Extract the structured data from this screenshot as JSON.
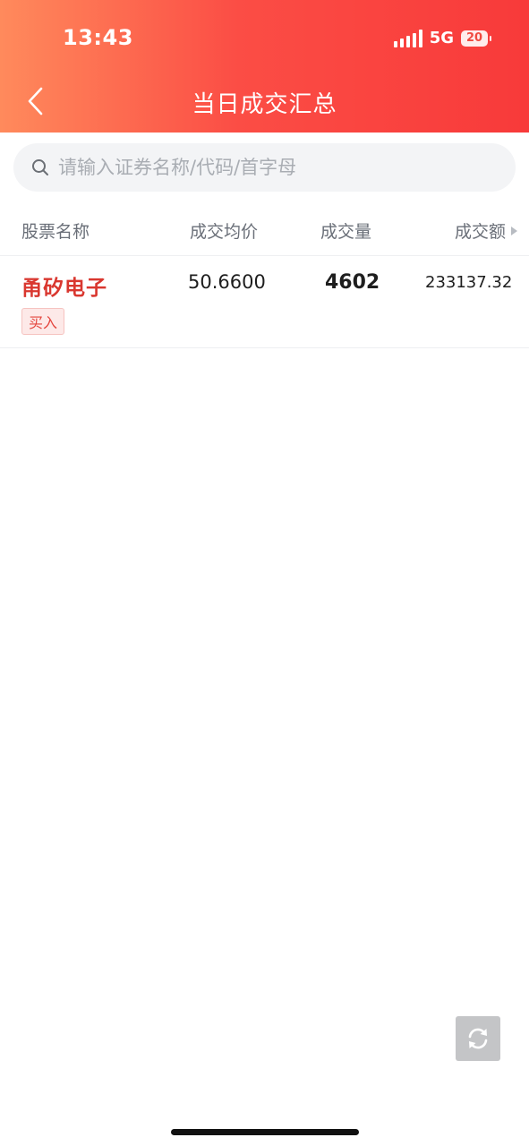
{
  "status_bar": {
    "time": "13:43",
    "network": "5G",
    "battery": "20"
  },
  "header": {
    "title": "当日成交汇总"
  },
  "search": {
    "placeholder": "请输入证券名称/代码/首字母"
  },
  "table": {
    "columns": [
      "股票名称",
      "成交均价",
      "成交量",
      "成交额"
    ],
    "rows": [
      {
        "name": "甬矽电子",
        "side": "买入",
        "avg_price": "50.6600",
        "volume": "4602",
        "amount": "233137.32"
      }
    ]
  },
  "icons": {
    "back": "chevron-left-icon",
    "search": "search-icon",
    "refresh": "refresh-icon",
    "sort": "sort-right-icon"
  },
  "colors": {
    "header_start": "#ff8a5c",
    "header_end": "#f83a3a",
    "stock_red": "#d9372f",
    "refresh_bg": "#c4c5c7"
  }
}
